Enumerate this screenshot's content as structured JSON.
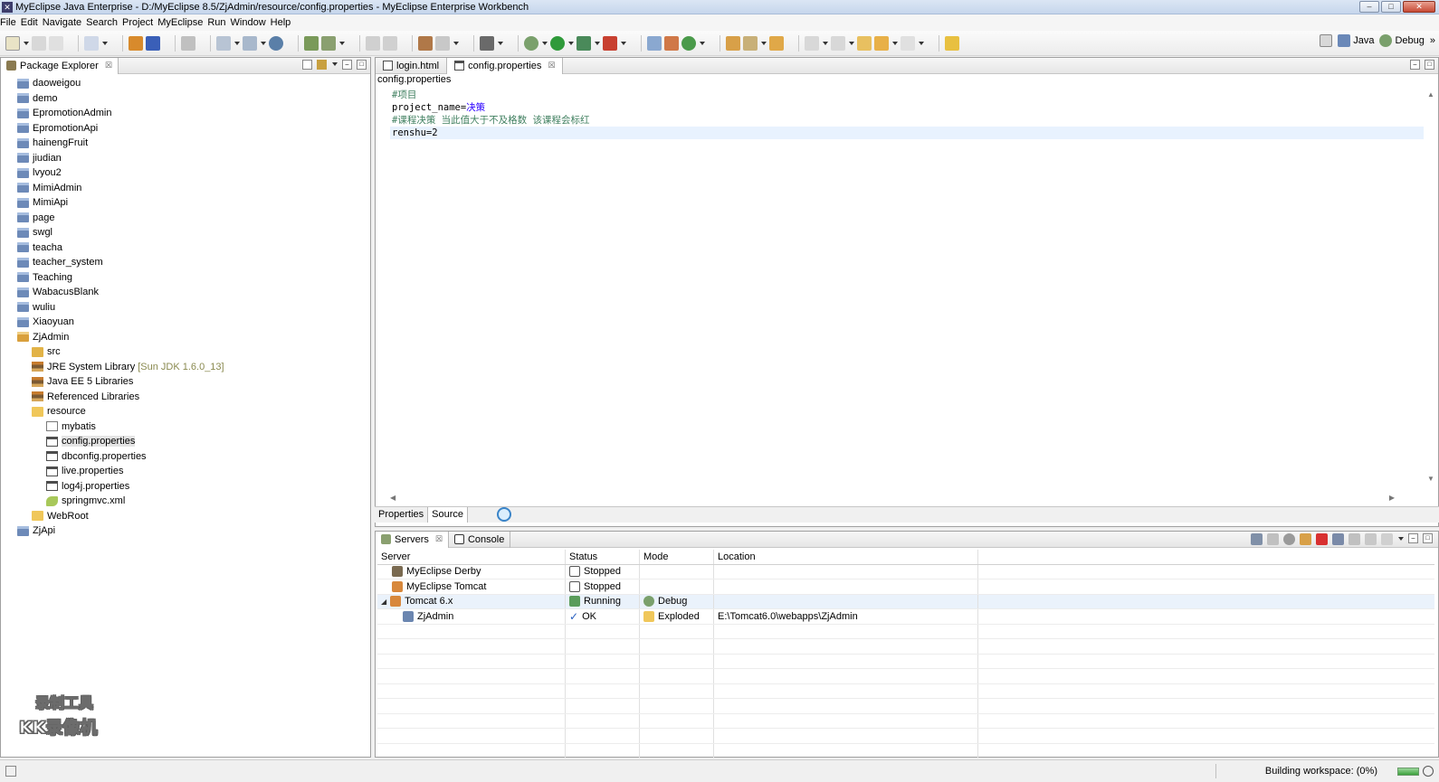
{
  "window": {
    "title": "MyEclipse Java Enterprise - D:/MyEclipse 8.5/ZjAdmin/resource/config.properties - MyEclipse Enterprise Workbench",
    "minimize_glyph": "–",
    "maximize_glyph": "□",
    "close_glyph": "✕"
  },
  "menu": [
    "File",
    "Edit",
    "Navigate",
    "Search",
    "Project",
    "MyEclipse",
    "Run",
    "Window",
    "Help"
  ],
  "perspectives": {
    "java": "Java",
    "debug": "Debug",
    "more": "»"
  },
  "package_explorer": {
    "tab_label": "Package Explorer",
    "close_glyph": "☒",
    "items": [
      {
        "label": "daoweigou",
        "indent": 0,
        "icon": "project"
      },
      {
        "label": "demo",
        "indent": 0,
        "icon": "project"
      },
      {
        "label": "EpromotionAdmin",
        "indent": 0,
        "icon": "project"
      },
      {
        "label": "EpromotionApi",
        "indent": 0,
        "icon": "project"
      },
      {
        "label": "hainengFruit",
        "indent": 0,
        "icon": "project"
      },
      {
        "label": "jiudian",
        "indent": 0,
        "icon": "project"
      },
      {
        "label": "lvyou2",
        "indent": 0,
        "icon": "project"
      },
      {
        "label": "MimiAdmin",
        "indent": 0,
        "icon": "project"
      },
      {
        "label": "MimiApi",
        "indent": 0,
        "icon": "project"
      },
      {
        "label": "page",
        "indent": 0,
        "icon": "project"
      },
      {
        "label": "swgl",
        "indent": 0,
        "icon": "project"
      },
      {
        "label": "teacha",
        "indent": 0,
        "icon": "project"
      },
      {
        "label": "teacher_system",
        "indent": 0,
        "icon": "project"
      },
      {
        "label": "Teaching",
        "indent": 0,
        "icon": "project"
      },
      {
        "label": "WabacusBlank",
        "indent": 0,
        "icon": "project"
      },
      {
        "label": "wuliu",
        "indent": 0,
        "icon": "project"
      },
      {
        "label": "Xiaoyuan",
        "indent": 0,
        "icon": "project"
      },
      {
        "label": "ZjAdmin",
        "indent": 0,
        "icon": "project-open"
      },
      {
        "label": "src",
        "indent": 1,
        "icon": "src"
      },
      {
        "label": "JRE System Library",
        "tag": "[Sun JDK 1.6.0_13]",
        "indent": 1,
        "icon": "lib"
      },
      {
        "label": "Java EE 5 Libraries",
        "indent": 1,
        "icon": "lib"
      },
      {
        "label": "Referenced Libraries",
        "indent": 1,
        "icon": "lib"
      },
      {
        "label": "resource",
        "indent": 1,
        "icon": "folder"
      },
      {
        "label": "mybatis",
        "indent": 2,
        "icon": "pkgico"
      },
      {
        "label": "config.properties",
        "indent": 2,
        "icon": "file",
        "selected": true
      },
      {
        "label": "dbconfig.properties",
        "indent": 2,
        "icon": "file"
      },
      {
        "label": "live.properties",
        "indent": 2,
        "icon": "file"
      },
      {
        "label": "log4j.properties",
        "indent": 2,
        "icon": "file"
      },
      {
        "label": "springmvc.xml",
        "indent": 2,
        "icon": "xml"
      },
      {
        "label": "WebRoot",
        "indent": 1,
        "icon": "folder"
      },
      {
        "label": "ZjApi",
        "indent": 0,
        "icon": "project"
      }
    ]
  },
  "watermark": {
    "line1": "录制工具",
    "line2": "KK录像机"
  },
  "editor": {
    "tabs": [
      {
        "label": "login.html",
        "active": false
      },
      {
        "label": "config.properties",
        "active": true
      }
    ],
    "close_glyph": "☒",
    "breadcrumb": "config.properties",
    "lines": [
      {
        "type": "comment",
        "text": "#项目"
      },
      {
        "type": "pair",
        "key": "project_name=",
        "value": "决策"
      },
      {
        "type": "comment",
        "text": "#课程决策 当此值大于不及格数 该课程会标红"
      },
      {
        "type": "pair",
        "key": "renshu=2",
        "value": "",
        "current": true
      }
    ],
    "bottom_tabs": [
      "Properties",
      "Source"
    ],
    "scroll_up": "▲",
    "scroll_down": "▼",
    "scroll_left": "◀",
    "scroll_right": "▶"
  },
  "servers_view": {
    "tabs": [
      {
        "label": "Servers",
        "active": true
      },
      {
        "label": "Console",
        "active": false
      }
    ],
    "close_glyph": "☒",
    "columns": [
      "Server",
      "Status",
      "Mode",
      "Location"
    ],
    "rows": [
      {
        "server": "MyEclipse Derby",
        "server_icon": "derby",
        "status": "Stopped",
        "status_icon": "stop",
        "mode": "",
        "location": "",
        "indent": 1
      },
      {
        "server": "MyEclipse Tomcat",
        "server_icon": "tomcat",
        "status": "Stopped",
        "status_icon": "stop",
        "mode": "",
        "location": "",
        "indent": 1
      },
      {
        "server": "Tomcat  6.x",
        "server_icon": "tomcat",
        "status": "Running",
        "status_icon": "run",
        "mode": "Debug",
        "mode_icon": "debug",
        "location": "",
        "indent": 0,
        "expanded": true,
        "selected": true
      },
      {
        "server": "ZjAdmin",
        "server_icon": "app",
        "status": "OK",
        "status_icon": "check",
        "mode": "Exploded",
        "mode_icon": "folder",
        "location": "E:\\Tomcat6.0\\webapps\\ZjAdmin",
        "indent": 2
      }
    ],
    "expander_glyph": "◢",
    "check_glyph": "✓"
  },
  "status_bar": {
    "text": "Building workspace: (0%)",
    "progress": 0
  },
  "colors": {
    "comment": "#3f7f5f",
    "value": "#2a00ff",
    "current_line": "#e8f2fe",
    "selection": "#eaf2fb"
  }
}
